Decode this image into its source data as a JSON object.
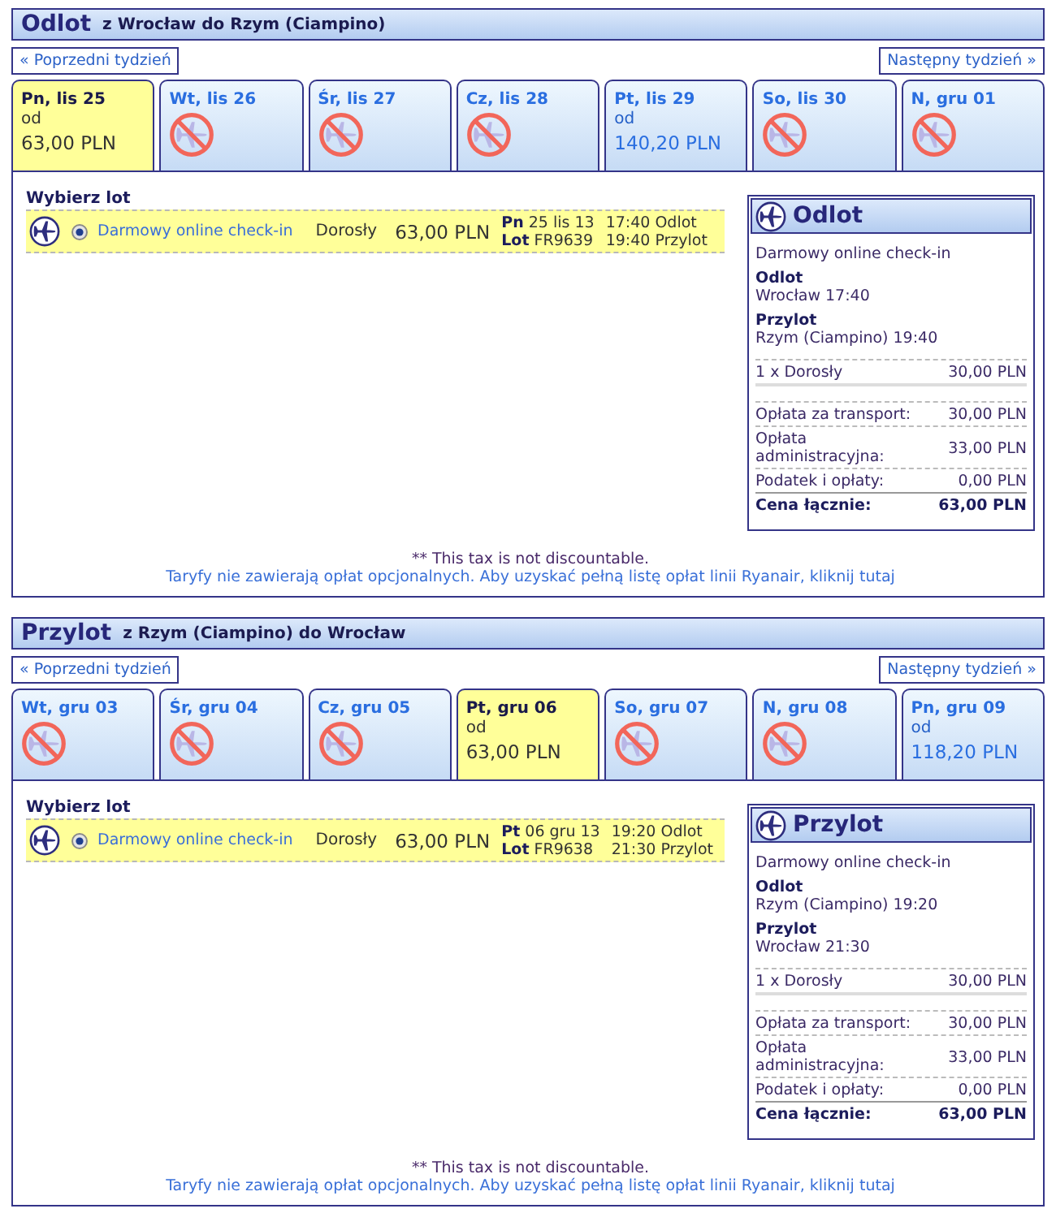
{
  "sections": [
    {
      "title": "Odlot",
      "route": "z Wrocław do Rzym (Ciampino)",
      "prev_week": "« Poprzedni tydzień",
      "next_week": "Następny tydzień »",
      "days": [
        {
          "label": "Pn, lis 25",
          "selected": true,
          "available": true,
          "from": "od",
          "price": "63,00 PLN"
        },
        {
          "label": "Wt, lis 26",
          "selected": false,
          "available": false
        },
        {
          "label": "Śr, lis 27",
          "selected": false,
          "available": false
        },
        {
          "label": "Cz, lis 28",
          "selected": false,
          "available": false
        },
        {
          "label": "Pt, lis 29",
          "selected": false,
          "available": true,
          "from": "od",
          "price": "140,20 PLN"
        },
        {
          "label": "So, lis 30",
          "selected": false,
          "available": false
        },
        {
          "label": "N, gru 01",
          "selected": false,
          "available": false
        }
      ],
      "choose_label": "Wybierz lot",
      "flight": {
        "selected": true,
        "fare": "Darmowy online check-in",
        "passenger": "Dorosły",
        "price": "63,00 PLN",
        "date": "**Pn** 25 lis 13",
        "flight_number": "**Lot** FR9639",
        "departure": "17:40 Odlot",
        "arrival": "19:40 Przylot"
      },
      "summary": {
        "title": "Odlot",
        "fare": "Darmowy online check-in",
        "legs": [
          {
            "label": "Odlot",
            "detail": "Wrocław 17:40"
          },
          {
            "label": "Przylot",
            "detail": "Rzym (Ciampino) 19:40"
          }
        ],
        "passengers": [
          {
            "label": "1 x Dorosły",
            "amount": "30,00 PLN"
          }
        ],
        "fees": [
          {
            "label": "Opłata za transport:",
            "amount": "30,00 PLN"
          },
          {
            "label": "Opłata administracyjna:",
            "amount": "33,00 PLN"
          },
          {
            "label": "Podatek i opłaty:",
            "amount": "0,00 PLN"
          }
        ],
        "total": {
          "label": "Cena łącznie:",
          "amount": "63,00 PLN"
        }
      },
      "tax_note": "** This tax is not discountable.",
      "fees_note": "Taryfy nie zawierają opłat opcjonalnych. Aby uzyskać pełną listę opłat linii Ryanair, kliknij tutaj"
    },
    {
      "title": "Przylot",
      "route": "z Rzym (Ciampino) do Wrocław",
      "prev_week": "« Poprzedni tydzień",
      "next_week": "Następny tydzień »",
      "days": [
        {
          "label": "Wt, gru 03",
          "selected": false,
          "available": false
        },
        {
          "label": "Śr, gru 04",
          "selected": false,
          "available": false
        },
        {
          "label": "Cz, gru 05",
          "selected": false,
          "available": false
        },
        {
          "label": "Pt, gru 06",
          "selected": true,
          "available": true,
          "from": "od",
          "price": "63,00 PLN"
        },
        {
          "label": "So, gru 07",
          "selected": false,
          "available": false
        },
        {
          "label": "N, gru 08",
          "selected": false,
          "available": false
        },
        {
          "label": "Pn, gru 09",
          "selected": false,
          "available": true,
          "from": "od",
          "price": "118,20 PLN"
        }
      ],
      "choose_label": "Wybierz lot",
      "flight": {
        "selected": true,
        "fare": "Darmowy online check-in",
        "passenger": "Dorosły",
        "price": "63,00 PLN",
        "date": "**Pt** 06 gru 13",
        "flight_number": "**Lot** FR9638",
        "departure": "19:20 Odlot",
        "arrival": "21:30 Przylot"
      },
      "summary": {
        "title": "Przylot",
        "fare": "Darmowy online check-in",
        "legs": [
          {
            "label": "Odlot",
            "detail": "Rzym (Ciampino) 19:20"
          },
          {
            "label": "Przylot",
            "detail": "Wrocław 21:30"
          }
        ],
        "passengers": [
          {
            "label": "1 x Dorosły",
            "amount": "30,00 PLN"
          }
        ],
        "fees": [
          {
            "label": "Opłata za transport:",
            "amount": "30,00 PLN"
          },
          {
            "label": "Opłata administracyjna:",
            "amount": "33,00 PLN"
          },
          {
            "label": "Podatek i opłaty:",
            "amount": "0,00 PLN"
          }
        ],
        "total": {
          "label": "Cena łącznie:",
          "amount": "63,00 PLN"
        }
      },
      "tax_note": "** This tax is not discountable.",
      "fees_note": "Taryfy nie zawierają opłat opcjonalnych. Aby uzyskać pełną listę opłat linii Ryanair, kliknij tutaj"
    }
  ]
}
